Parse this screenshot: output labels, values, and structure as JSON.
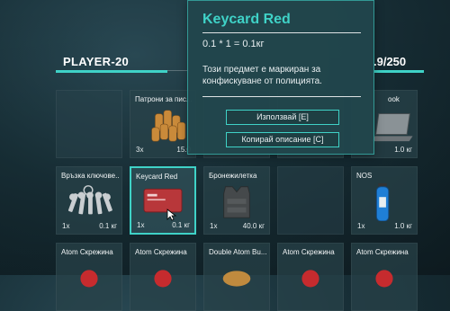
{
  "player": {
    "name": "PLAYER-20"
  },
  "other_panel": {
    "weight_fragment": ".9/250"
  },
  "slots": [
    {
      "name": "",
      "count": "",
      "weight": "",
      "icon": "empty"
    },
    {
      "name": "Патрони за пис...",
      "count": "3x",
      "weight": "15.0",
      "icon": "bullets-icon"
    },
    {
      "name": "",
      "count": "",
      "weight": "",
      "icon": "hidden-by-tooltip"
    },
    {
      "name": "",
      "count": "",
      "weight": "",
      "icon": "hidden-by-tooltip"
    },
    {
      "name": "ook",
      "count": "",
      "weight": "1.0 кг",
      "icon": "laptop-icon"
    },
    {
      "name": "Връзка ключове...",
      "count": "1x",
      "weight": "0.1 кг",
      "icon": "keys-icon"
    },
    {
      "name": "Keycard Red",
      "count": "1x",
      "weight": "0.1 кг",
      "icon": "keycard-icon"
    },
    {
      "name": "Бронежилетка",
      "count": "1x",
      "weight": "40.0 кг",
      "icon": "vest-icon"
    },
    {
      "name": "",
      "count": "",
      "weight": "",
      "icon": "empty"
    },
    {
      "name": "NOS",
      "count": "1x",
      "weight": "1.0 кг",
      "icon": "nos-bottle-icon"
    },
    {
      "name": "Atom Скрежина",
      "count": "",
      "weight": "",
      "icon": "drink-cup-icon"
    },
    {
      "name": "Atom Скрежина",
      "count": "",
      "weight": "",
      "icon": "drink-cup-icon"
    },
    {
      "name": "Double Atom Bu...",
      "count": "",
      "weight": "",
      "icon": "burger-icon"
    },
    {
      "name": "Atom Скрежина",
      "count": "",
      "weight": "",
      "icon": "drink-cup-icon"
    },
    {
      "name": "Atom Скрежина",
      "count": "",
      "weight": "",
      "icon": "drink-cup-icon"
    }
  ],
  "tooltip": {
    "title": "Keycard Red",
    "weight_formula": "0.1 * 1 = 0.1кг",
    "description": "Този предмет е маркиран за конфискуване от полицията.",
    "use_button": "Използвай [E]",
    "copy_button": "Копирай описание [C]"
  },
  "colors": {
    "accent": "#3fd2c7",
    "slot_bg": "#28424a",
    "tooltip_bg": "#21464c"
  }
}
